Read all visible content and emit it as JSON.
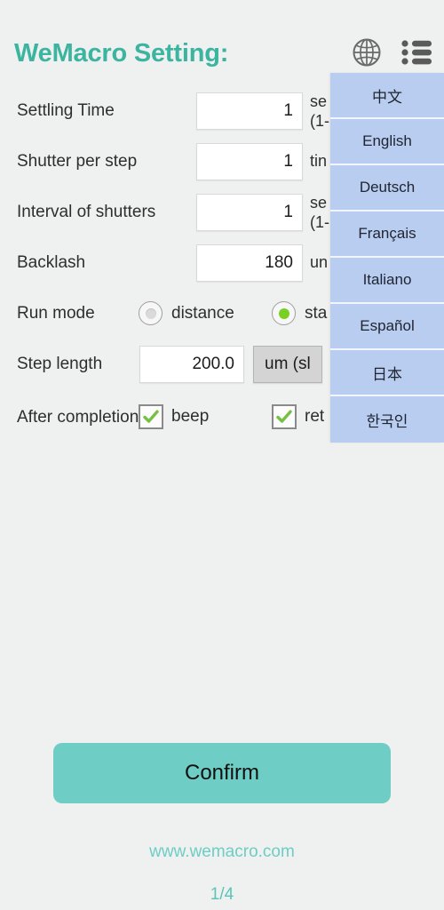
{
  "header": {
    "title": "WeMacro Setting:",
    "globe_icon": "globe-icon",
    "list_icon": "list-menu-icon",
    "accent_color": "#3bb4a0"
  },
  "form": {
    "rows": [
      {
        "label": "Settling Time",
        "value": "1",
        "unit": "se",
        "unit_line2": "(1-"
      },
      {
        "label": "Shutter per step",
        "value": "1",
        "unit": "tin",
        "unit_line2": ""
      },
      {
        "label": "Interval of shutters",
        "value": "1",
        "unit": "se",
        "unit_line2": "(1-"
      },
      {
        "label": "Backlash",
        "value": "180",
        "unit": "un",
        "unit_line2": ""
      }
    ],
    "run_mode": {
      "label": "Run mode",
      "options": [
        {
          "label": "distance",
          "selected": false
        },
        {
          "label": "sta",
          "selected": true
        }
      ],
      "selected_color": "#79cf22"
    },
    "step_length": {
      "label": "Step length",
      "value": "200.0",
      "unit_select": "um (sl"
    },
    "after_completion": {
      "label": "After completion",
      "options": [
        {
          "label": "beep",
          "checked": true
        },
        {
          "label": "ret",
          "checked": true
        }
      ],
      "check_color": "#76c043"
    }
  },
  "language_menu": {
    "items": [
      {
        "label": "中文"
      },
      {
        "label": "English"
      },
      {
        "label": "Deutsch"
      },
      {
        "label": "Français"
      },
      {
        "label": "Italiano"
      },
      {
        "label": "Español"
      },
      {
        "label": "日本"
      },
      {
        "label": "한국인"
      }
    ],
    "background_color": "#b8cdf0"
  },
  "footer": {
    "confirm_label": "Confirm",
    "confirm_color": "#6ecdc4",
    "website": "www.wemacro.com",
    "page_indicator": "1/4"
  }
}
